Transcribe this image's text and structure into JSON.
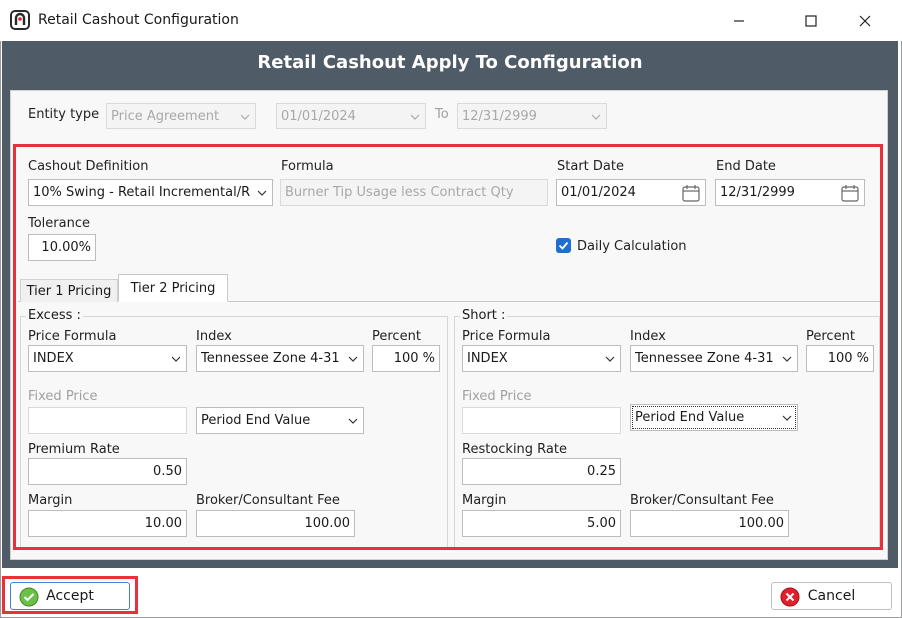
{
  "window": {
    "title": "Retail Cashout Configuration",
    "minimize_icon": "minimize-icon",
    "maximize_icon": "maximize-icon",
    "close_icon": "close-icon"
  },
  "header": {
    "title": "Retail Cashout Apply To Configuration"
  },
  "entity": {
    "type_label": "Entity type",
    "type_value": "Price Agreement",
    "from_date": "01/01/2024",
    "to_label": "To",
    "to_date": "12/31/2999"
  },
  "definition": {
    "cashout_label": "Cashout Definition",
    "cashout_value": "10% Swing - Retail Incremental/R",
    "formula_label": "Formula",
    "formula_value": "Burner Tip Usage less Contract Qty",
    "start_label": "Start Date",
    "start_value": "01/01/2024",
    "end_label": "End Date",
    "end_value": "12/31/2999",
    "tolerance_label": "Tolerance",
    "tolerance_value": "10.00%",
    "daily_label": "Daily Calculation",
    "daily_checked": true
  },
  "tabs": [
    {
      "label": "Tier 1 Pricing",
      "active": false
    },
    {
      "label": "Tier 2 Pricing",
      "active": true
    }
  ],
  "excess": {
    "title": "Excess :",
    "price_formula_label": "Price Formula",
    "price_formula_value": "INDEX",
    "index_label": "Index",
    "index_value": "Tennessee Zone 4-31",
    "percent_label": "Percent",
    "percent_value": "100 %",
    "fixed_price_label": "Fixed Price",
    "fixed_price_value": "",
    "period_value": "Period End Value",
    "rate_label": "Premium Rate",
    "rate_value": "0.50",
    "margin_label": "Margin",
    "margin_value": "10.00",
    "fee_label": "Broker/Consultant Fee",
    "fee_value": "100.00"
  },
  "short": {
    "title": "Short :",
    "price_formula_label": "Price Formula",
    "price_formula_value": "INDEX",
    "index_label": "Index",
    "index_value": "Tennessee Zone 4-31",
    "percent_label": "Percent",
    "percent_value": "100 %",
    "fixed_price_label": "Fixed Price",
    "fixed_price_value": "",
    "period_value": "Period End Value",
    "rate_label": "Restocking Rate",
    "rate_value": "0.25",
    "margin_label": "Margin",
    "margin_value": "5.00",
    "fee_label": "Broker/Consultant Fee",
    "fee_value": "100.00"
  },
  "buttons": {
    "accept_label": "Accept",
    "cancel_label": "Cancel"
  },
  "colors": {
    "panel_dark": "#4f5b66",
    "highlight_red": "#e8313a",
    "check_blue": "#1e6fd0",
    "accept_green": "#6cc04a",
    "cancel_red": "#e0202b"
  }
}
